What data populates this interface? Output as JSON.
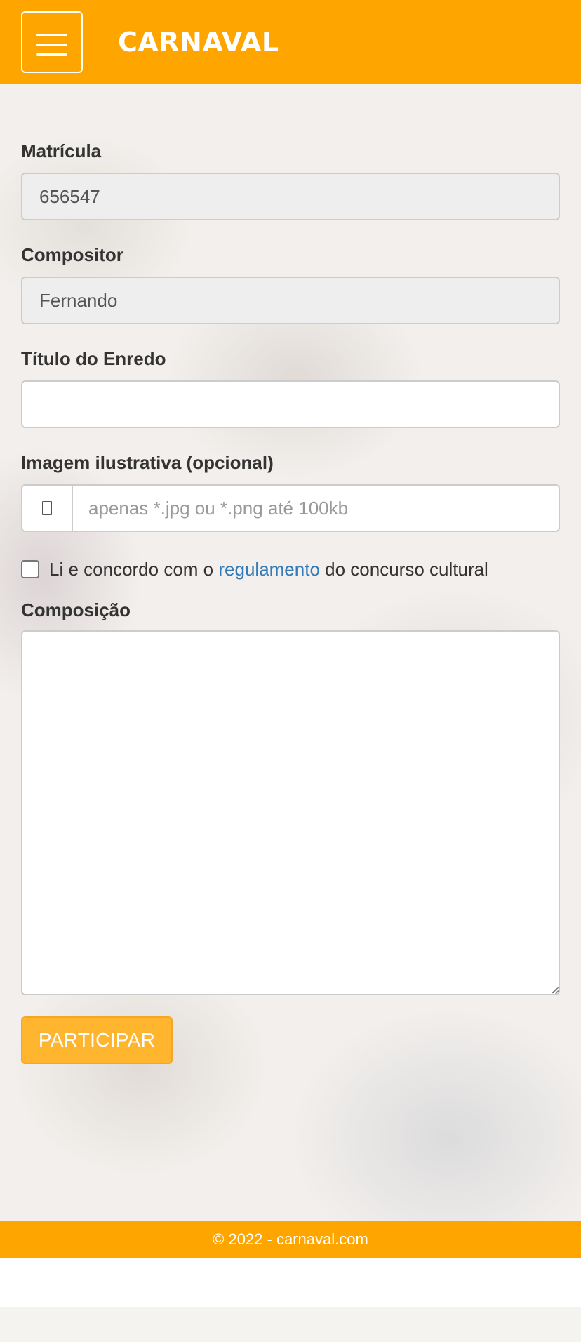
{
  "header": {
    "brand": "CARNAVAL",
    "menu_icon": "hamburger-menu-icon"
  },
  "form": {
    "matricula": {
      "label": "Matrícula",
      "value": "656547"
    },
    "compositor": {
      "label": "Compositor",
      "value": "Fernando"
    },
    "titulo": {
      "label": "Título do Enredo",
      "value": ""
    },
    "imagem": {
      "label": "Imagem ilustrativa (opcional)",
      "placeholder": "apenas *.jpg ou *.png até 100kb",
      "icon": "file-icon"
    },
    "agree": {
      "prefix": "Li e concordo com o",
      "link": "regulamento",
      "suffix": "do concurso cultural",
      "checked": false
    },
    "composicao": {
      "label": "Composição",
      "value": ""
    },
    "submit_label": "PARTICIPAR"
  },
  "footer": {
    "text": "© 2022 - carnaval.com"
  },
  "colors": {
    "brand": "#ffa500",
    "button": "#ffb52e",
    "link": "#337ab7"
  }
}
